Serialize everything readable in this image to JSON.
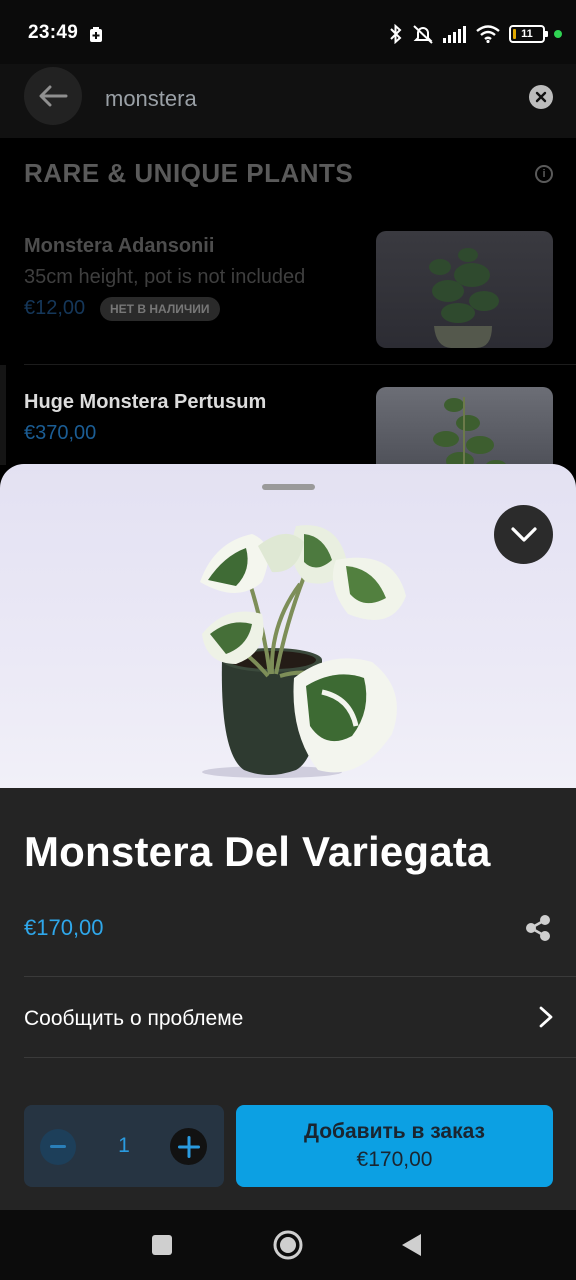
{
  "status_bar": {
    "time": "23:49",
    "battery_level": "11",
    "icons": [
      "sim-save-icon",
      "bluetooth-icon",
      "bell-off-icon",
      "signal-icon",
      "wifi-icon",
      "battery-icon",
      "dot-indicator"
    ]
  },
  "search": {
    "query": "monstera"
  },
  "list": {
    "section_title": "RARE & UNIQUE PLANTS",
    "items": [
      {
        "name": "Monstera Adansonii",
        "description": "35cm height, pot is not included",
        "price": "€12,00",
        "badge": "НЕТ В НАЛИЧИИ"
      },
      {
        "name": "Huge Monstera Pertusum",
        "price": "€370,00"
      }
    ]
  },
  "sheet": {
    "title": "Monstera Del Variegata",
    "price": "€170,00",
    "report_label": "Сообщить о проблеме",
    "quantity": "1",
    "add_button_label": "Добавить в заказ",
    "add_button_price": "€170,00"
  },
  "colors": {
    "accent": "#0ca0e3",
    "price_blue": "#2fa7ea",
    "sheet_bg": "#242424"
  }
}
